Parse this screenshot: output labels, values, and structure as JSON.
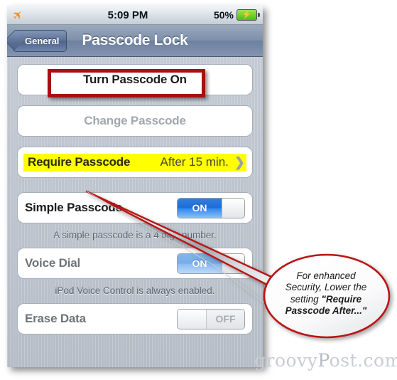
{
  "statusbar": {
    "airplane_icon": "airplane-icon",
    "time": "5:09 PM",
    "battery_percent": "50%",
    "battery_icon": "battery-charging-icon"
  },
  "navbar": {
    "back_label": "General",
    "title": "Passcode Lock"
  },
  "settings": {
    "turn_passcode": {
      "label": "Turn Passcode On",
      "highlight_color": "#a80f0f"
    },
    "change_passcode": {
      "label": "Change Passcode"
    },
    "require_passcode": {
      "label": "Require Passcode",
      "value": "After 15 min.",
      "chevron": "chevron-right-icon",
      "highlight_color": "#ffff00"
    },
    "simple_passcode": {
      "label": "Simple Passcode",
      "toggle_state": "ON"
    },
    "simple_passcode_hint": "A simple passcode is a 4 digit number.",
    "voice_dial": {
      "label": "Voice Dial",
      "toggle_state": "ON"
    },
    "voice_dial_hint": "iPod Voice Control is always enabled.",
    "erase_data": {
      "label": "Erase Data",
      "toggle_state": "OFF"
    }
  },
  "annotation": {
    "callout_line1": "For enhanced",
    "callout_line2": "Security, Lower the",
    "callout_line3": "setting ",
    "callout_bold1": "\"Require",
    "callout_bold2": "Passcode After...\"",
    "outline_color": "#b81414"
  },
  "watermark": {
    "text_pre": "g",
    "text_main": "roovy",
    "text_cap": "P",
    "text_post": "ost.com"
  }
}
